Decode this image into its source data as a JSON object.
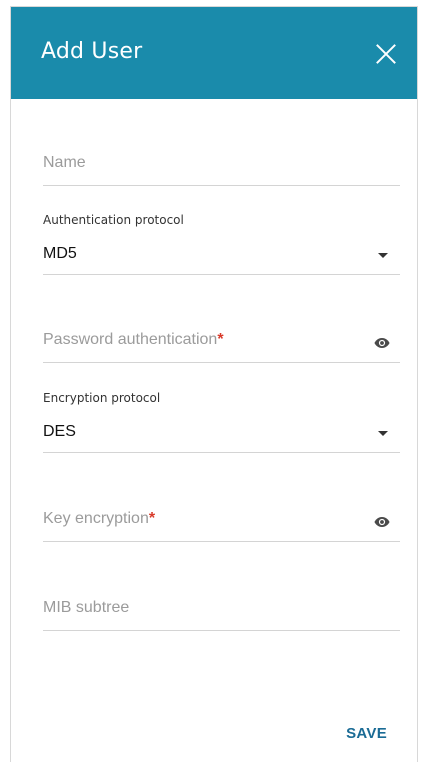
{
  "dialog": {
    "title": "Add User",
    "close_icon": "close-icon",
    "header_color": "#1a8bab"
  },
  "form": {
    "name": {
      "placeholder": "Name",
      "value": ""
    },
    "auth_protocol": {
      "label": "Authentication protocol",
      "value": "MD5",
      "icon": "chevron-down-icon"
    },
    "password_auth": {
      "placeholder": "Password authentication",
      "required_mark": "*",
      "icon": "eye-icon"
    },
    "encryption_protocol": {
      "label": "Encryption protocol",
      "value": "DES",
      "icon": "chevron-down-icon"
    },
    "key_encryption": {
      "placeholder": "Key encryption",
      "required_mark": "*",
      "icon": "eye-icon"
    },
    "mib_subtree": {
      "placeholder": "MIB subtree",
      "value": ""
    }
  },
  "actions": {
    "save_label": "SAVE",
    "save_color": "#1a6b95"
  }
}
